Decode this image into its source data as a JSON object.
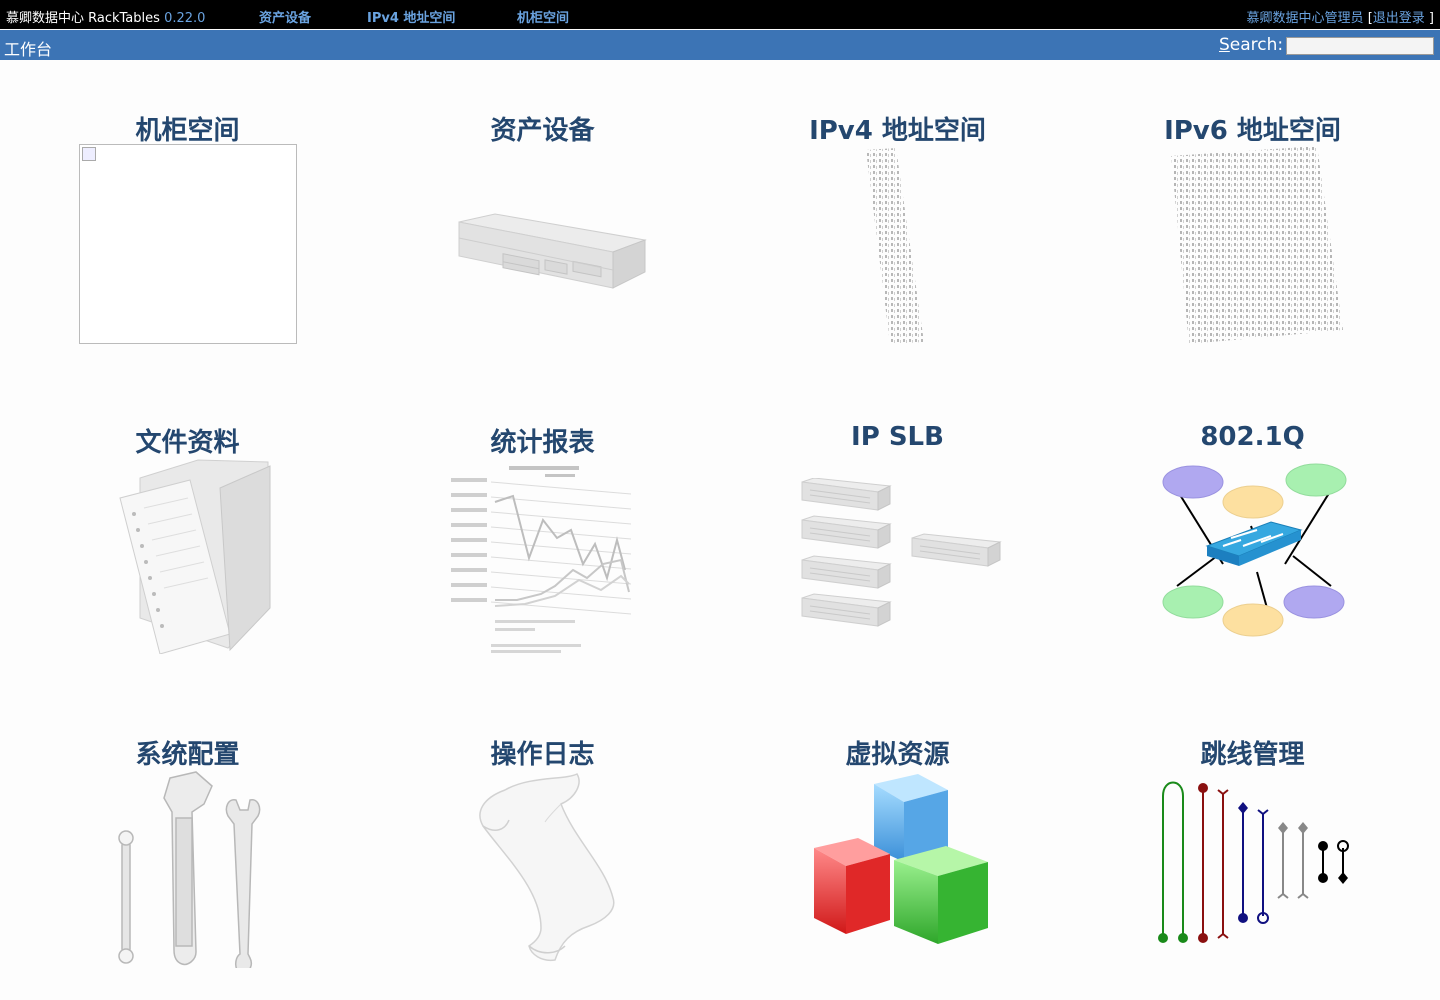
{
  "topbar": {
    "brand": "慕卿数据中心 RackTables",
    "version": "0.22.0",
    "nav": [
      "资产设备",
      "IPv4 地址空间",
      "机柜空间"
    ],
    "user_name": "慕卿数据中心管理员",
    "logout_prefix": "[",
    "logout_label": "退出登录",
    "logout_suffix": "]"
  },
  "bluebar": {
    "breadcrumb": "工作台",
    "search_letter": "S",
    "search_rest": "earch:",
    "search_value": ""
  },
  "tiles": [
    {
      "title": "机柜空间",
      "icon": "broken-image-icon"
    },
    {
      "title": "资产设备",
      "icon": "server-icon"
    },
    {
      "title": "IPv4 地址空间",
      "icon": "ipv4-binary-icon"
    },
    {
      "title": "IPv6 地址空间",
      "icon": "ipv6-binary-icon"
    },
    {
      "title": "文件资料",
      "icon": "folder-icon"
    },
    {
      "title": "统计报表",
      "icon": "report-chart-icon"
    },
    {
      "title": "IP SLB",
      "icon": "load-balancer-icon"
    },
    {
      "title": "802.1Q",
      "icon": "vlan-switch-icon"
    },
    {
      "title": "系统配置",
      "icon": "tools-icon"
    },
    {
      "title": "操作日志",
      "icon": "scroll-icon"
    },
    {
      "title": "虚拟资源",
      "icon": "cubes-icon"
    },
    {
      "title": "跳线管理",
      "icon": "patch-cable-icon"
    }
  ],
  "colors": {
    "topbar": "#000000",
    "bluebar": "#3c74b5",
    "link": "#6aa3e0",
    "title": "#24476f"
  }
}
